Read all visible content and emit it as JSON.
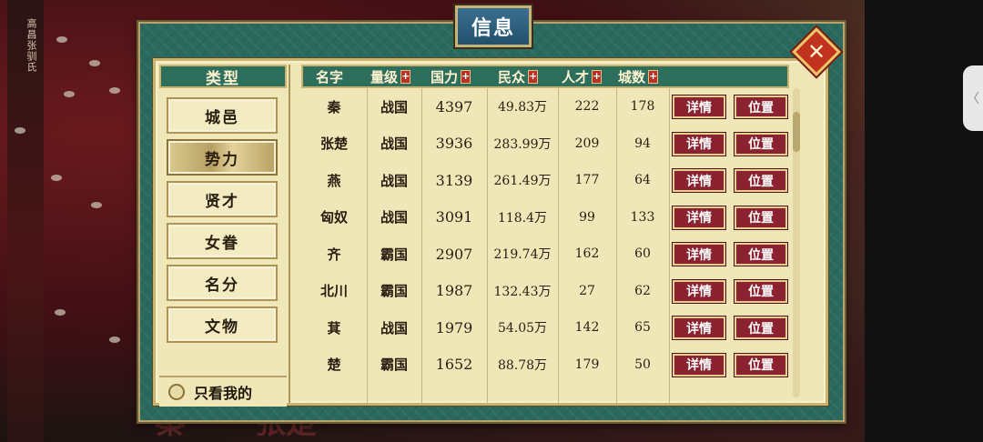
{
  "background": {
    "vertical_label": "高昌张驯氏",
    "bottom_text_1": "秦",
    "bottom_text_2": "张楚"
  },
  "panel": {
    "title": "信息",
    "close_symbol": "✕"
  },
  "categories": {
    "header": "类型",
    "items": [
      {
        "label": "城邑"
      },
      {
        "label": "势力",
        "active": true
      },
      {
        "label": "贤才"
      },
      {
        "label": "女眷"
      },
      {
        "label": "名分"
      },
      {
        "label": "文物"
      }
    ],
    "only_mine_label": "只看我的"
  },
  "table": {
    "columns": [
      "名字",
      "量级",
      "国力",
      "民众",
      "人才",
      "城数"
    ],
    "sort_symbol": "+",
    "detail_label": "详情",
    "location_label": "位置",
    "rows": [
      {
        "name": "秦",
        "level": "战国",
        "power": "4397",
        "people": "49.83万",
        "talent": "222",
        "cities": "178"
      },
      {
        "name": "张楚",
        "level": "战国",
        "power": "3936",
        "people": "283.99万",
        "talent": "209",
        "cities": "94"
      },
      {
        "name": "燕",
        "level": "战国",
        "power": "3139",
        "people": "261.49万",
        "talent": "177",
        "cities": "64"
      },
      {
        "name": "匈奴",
        "level": "战国",
        "power": "3091",
        "people": "118.4万",
        "talent": "99",
        "cities": "133"
      },
      {
        "name": "齐",
        "level": "霸国",
        "power": "2907",
        "people": "219.74万",
        "talent": "162",
        "cities": "60"
      },
      {
        "name": "北川",
        "level": "霸国",
        "power": "1987",
        "people": "132.43万",
        "talent": "27",
        "cities": "62"
      },
      {
        "name": "萁",
        "level": "战国",
        "power": "1979",
        "people": "54.05万",
        "talent": "142",
        "cities": "65"
      },
      {
        "name": "楚",
        "level": "霸国",
        "power": "1652",
        "people": "88.78万",
        "talent": "179",
        "cities": "50"
      }
    ]
  },
  "side_tab": {
    "glyph": "〈"
  },
  "colors": {
    "panel_frame": "#2a6a5e",
    "parchment": "#efe7b8",
    "button_red": "#8a2230",
    "close_red": "#c2331f"
  }
}
